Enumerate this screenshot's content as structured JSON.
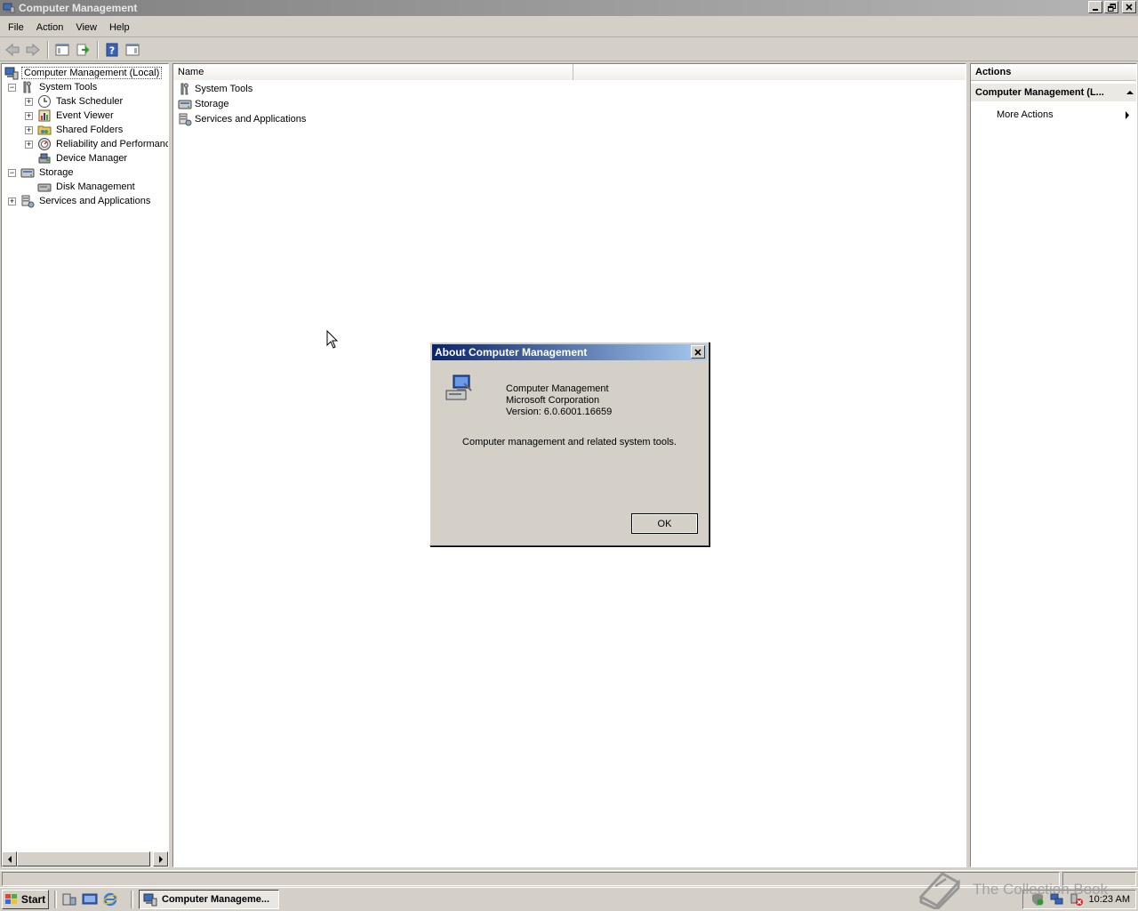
{
  "window": {
    "title": "Computer Management"
  },
  "menu": [
    "File",
    "Action",
    "View",
    "Help"
  ],
  "tree": {
    "root": "Computer Management (Local)",
    "system_tools": "System Tools",
    "task_scheduler": "Task Scheduler",
    "event_viewer": "Event Viewer",
    "shared_folders": "Shared Folders",
    "reliability": "Reliability and Performanc",
    "device_manager": "Device Manager",
    "storage": "Storage",
    "disk_management": "Disk Management",
    "services": "Services and Applications",
    "expanded_glyph": "−",
    "collapsed_glyph": "+"
  },
  "list": {
    "columns": [
      "Name",
      ""
    ],
    "items": [
      "System Tools",
      "Storage",
      "Services and Applications"
    ]
  },
  "actions": {
    "header": "Actions",
    "section": "Computer Management (L...",
    "more": "More Actions"
  },
  "dialog": {
    "title": "About Computer Management",
    "product": "Computer Management",
    "company": "Microsoft Corporation",
    "version": "Version: 6.0.6001.16659",
    "description": "Computer management and related system tools.",
    "ok": "OK"
  },
  "taskbar": {
    "start": "Start",
    "task_button": "Computer Manageme...",
    "clock": "10:23 AM"
  },
  "watermark": {
    "text": "The Collection Book"
  },
  "colors": {
    "dialog_title_start": "#0a246a",
    "dialog_title_end": "#a6caf0",
    "inactive_title": "#808080",
    "face": "#d4d0c8"
  }
}
